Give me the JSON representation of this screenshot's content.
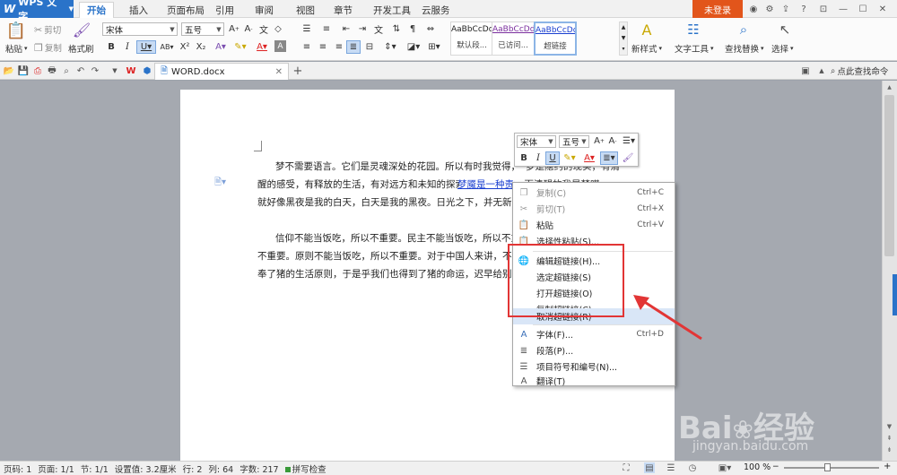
{
  "app": {
    "name": "WPS 文字",
    "login": "未登录"
  },
  "tabs": [
    "开始",
    "插入",
    "页面布局",
    "引用",
    "审阅",
    "视图",
    "章节",
    "开发工具",
    "云服务"
  ],
  "ribbon": {
    "paste": "粘贴",
    "cut": "剪切",
    "copy": "复制",
    "format_painter": "格式刷",
    "font": "宋体",
    "size": "五号",
    "styles": [
      {
        "sample": "AaBbCcDd",
        "name": "默认段..."
      },
      {
        "sample": "AaBbCcDd",
        "name": "已访问..."
      },
      {
        "sample": "AaBbCcDd",
        "name": "超链接"
      }
    ],
    "new_style": "新样式",
    "text_tools": "文字工具",
    "find_replace": "查找替换",
    "select": "选择"
  },
  "doc_tab": {
    "name": "WORD.docx"
  },
  "search": {
    "placeholder": "点此查找命令"
  },
  "document": {
    "p1_lines": [
      "梦不需要语言。它们是灵魂深处的花园。所以有时我觉得，",
      "醒的感受，有释放的生活，有对远方和未知的探索。",
      "就好像黑夜是我的白天，白天是我的黑夜。日光之下，并无新事"
    ],
    "p1_line1_tail": "梦是隐约的现实，有清",
    "p1_line2_link": "梦魇是一种责实",
    "p1_line2_tail": "，而清醒的我是梦呓",
    "p2_lines": [
      "信仰不能当饭吃，所以不重要。民主不能当饭吃，所以不重",
      "不重要。原则不能当饭吃，所以不重要。对于中国人来讲，不能当",
      "奉了猪的生活原则，于是乎我们也得到了猪的命运，迟早给别人"
    ]
  },
  "mini_toolbar": {
    "font": "宋体",
    "size": "五号"
  },
  "context_menu": [
    {
      "label": "复制(C)",
      "shortcut": "Ctrl+C",
      "icon": "copy-icon",
      "disabled": true
    },
    {
      "label": "剪切(T)",
      "shortcut": "Ctrl+X",
      "icon": "cut-icon",
      "disabled": true
    },
    {
      "label": "粘贴",
      "shortcut": "Ctrl+V",
      "icon": "paste-icon",
      "disabled": false
    },
    {
      "label": "选择性粘贴(S)...",
      "shortcut": "",
      "icon": "paste-special-icon",
      "disabled": false
    },
    {
      "label": "编辑超链接(H)...",
      "shortcut": "",
      "icon": "hyperlink-icon",
      "disabled": false
    },
    {
      "label": "选定超链接(S)",
      "shortcut": "",
      "icon": "",
      "disabled": false
    },
    {
      "label": "打开超链接(O)",
      "shortcut": "",
      "icon": "",
      "disabled": false
    },
    {
      "label": "复制超链接(C)",
      "shortcut": "",
      "icon": "",
      "disabled": false
    },
    {
      "label": "取消超链接(R)",
      "shortcut": "",
      "icon": "",
      "disabled": false
    },
    {
      "label": "字体(F)...",
      "shortcut": "Ctrl+D",
      "icon": "font-icon",
      "disabled": false
    },
    {
      "label": "段落(P)...",
      "shortcut": "",
      "icon": "paragraph-icon",
      "disabled": false
    },
    {
      "label": "项目符号和编号(N)...",
      "shortcut": "",
      "icon": "bullets-icon",
      "disabled": false
    },
    {
      "label": "翻译(T)",
      "shortcut": "",
      "icon": "translate-icon",
      "disabled": false
    }
  ],
  "status": {
    "page_num": "页码: 1",
    "pages": "页面: 1/1",
    "section": "节: 1/1",
    "setting": "设置值: 3.2厘米",
    "row": "行: 2",
    "col": "列: 64",
    "words": "字数: 217",
    "spell": "拼写检查",
    "zoom": "100 %"
  },
  "colors": {
    "accent": "#2a73c9",
    "login": "#e2551b",
    "highlight": "#e23535",
    "link": "#1a3fd0"
  }
}
